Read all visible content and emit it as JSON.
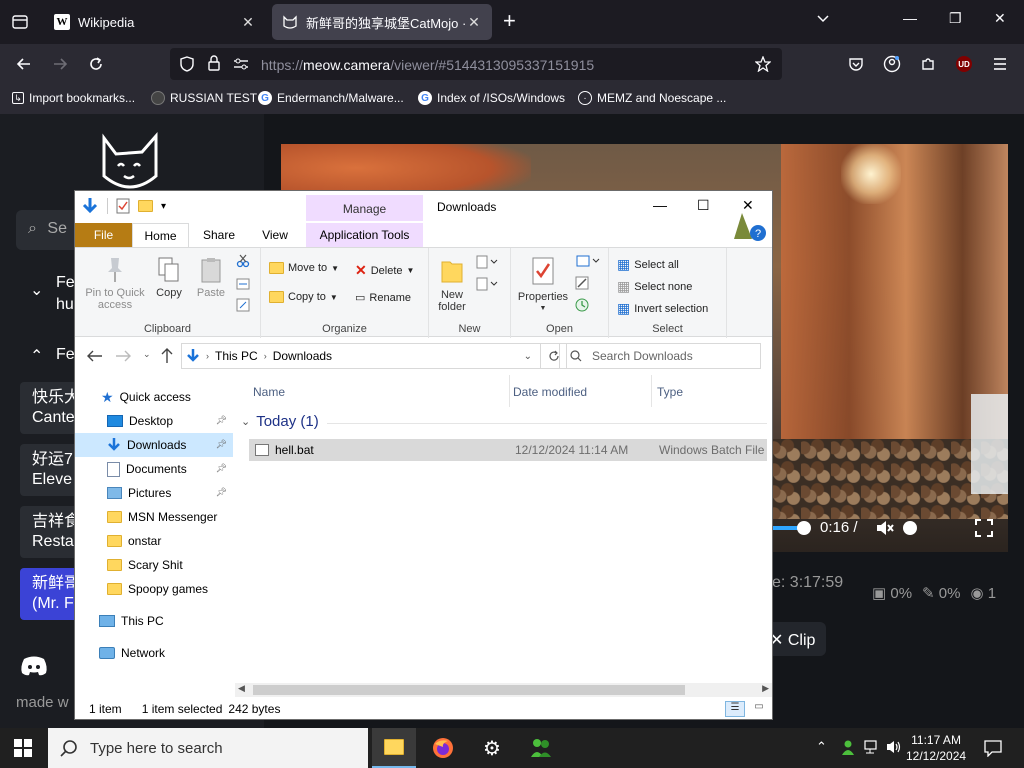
{
  "browser": {
    "tabs": [
      {
        "title": "Wikipedia",
        "icon": "wikipedia-icon"
      },
      {
        "title": "新鲜哥的独享城堡CatMojo · m",
        "icon": "cat-favicon"
      }
    ],
    "url": {
      "prefix": "https://",
      "host": "meow.camera",
      "path": "/viewer/#5144313095337151915"
    },
    "bookmarks": [
      {
        "label": "Import bookmarks...",
        "icon": "import-icon"
      },
      {
        "label": "RUSSIAN TEST",
        "icon": "bookmark-favicon"
      },
      {
        "label": "Endermanch/Malware...",
        "icon": "google-icon"
      },
      {
        "label": "Index of /ISOs/Windows",
        "icon": "google-icon"
      },
      {
        "label": "MEMZ and Noescape ...",
        "icon": "globe-icon"
      }
    ],
    "extension_badge": "UD"
  },
  "webpage": {
    "search_placeholder": "Se",
    "groups": [
      {
        "label": "Fe",
        "label2": "hu",
        "expanded": false
      },
      {
        "label": "Fe",
        "expanded": true
      }
    ],
    "items": [
      {
        "line1": "快乐大",
        "line2": "Cante"
      },
      {
        "line1": "好运7",
        "line2": "Eleve"
      },
      {
        "line1": "吉祥食",
        "line2": "Resta"
      },
      {
        "line1": "新鲜哥",
        "line2": "(Mr. F"
      }
    ],
    "made_with": "made w",
    "video": {
      "time": "0:16 /"
    },
    "uptime": "e: 3:17:59",
    "stats": {
      "cpu": "0%",
      "feed": "0%",
      "viewers": "1"
    },
    "clip_label": "Clip"
  },
  "explorer": {
    "window_title": "Downloads",
    "contextual_tab": "Manage",
    "tabs": [
      "File",
      "Home",
      "Share",
      "View",
      "Application Tools"
    ],
    "ribbon": {
      "clipboard": {
        "label": "Clipboard",
        "pin": "Pin to Quick access",
        "copy": "Copy",
        "paste": "Paste"
      },
      "organize": {
        "label": "Organize",
        "move_to": "Move to",
        "copy_to": "Copy to",
        "delete": "Delete",
        "rename": "Rename"
      },
      "new": {
        "label": "New",
        "new_folder": "New folder"
      },
      "open": {
        "label": "Open",
        "properties": "Properties"
      },
      "select": {
        "label": "Select",
        "select_all": "Select all",
        "select_none": "Select none",
        "invert": "Invert selection"
      }
    },
    "address": {
      "this_pc": "This PC",
      "downloads": "Downloads"
    },
    "search_placeholder": "Search Downloads",
    "nav": {
      "quick_access": "Quick access",
      "items": [
        "Desktop",
        "Downloads",
        "Documents",
        "Pictures",
        "MSN Messenger",
        "onstar",
        "Scary Shit",
        "Spoopy games"
      ],
      "this_pc": "This PC",
      "network": "Network"
    },
    "columns": {
      "name": "Name",
      "date": "Date modified",
      "type": "Type"
    },
    "group": "Today (1)",
    "file": {
      "name": "hell.bat",
      "date": "12/12/2024 11:14 AM",
      "type": "Windows Batch File"
    },
    "status": {
      "count": "1 item",
      "selected": "1 item selected",
      "size": "242 bytes"
    }
  },
  "taskbar": {
    "search_placeholder": "Type here to search",
    "time": "11:17 AM",
    "date": "12/12/2024"
  },
  "colors": {
    "accent": "#3b43d6",
    "file_tab": "#b67c14",
    "manage": "#f0dcff",
    "selection": "#cce8ff"
  }
}
